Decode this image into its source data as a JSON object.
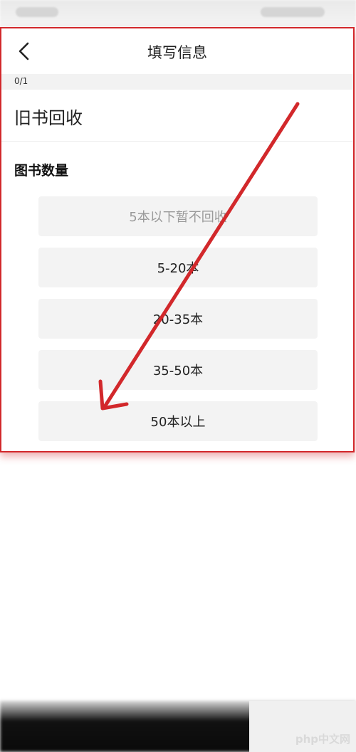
{
  "nav": {
    "title": "填写信息"
  },
  "progress": {
    "text": "0/1"
  },
  "category": {
    "title": "旧书回收"
  },
  "section": {
    "heading": "图书数量"
  },
  "options": [
    {
      "label": "5本以下暂不回收",
      "disabled": true
    },
    {
      "label": "5-20本",
      "disabled": false
    },
    {
      "label": "20-35本",
      "disabled": false
    },
    {
      "label": "35-50本",
      "disabled": false
    },
    {
      "label": "50本以上",
      "disabled": false
    }
  ],
  "watermark": {
    "text": "php中文网"
  },
  "colors": {
    "highlight": "#d2282b",
    "option_bg": "#f3f3f3"
  },
  "icons": {
    "back": "chevron-left-icon"
  }
}
